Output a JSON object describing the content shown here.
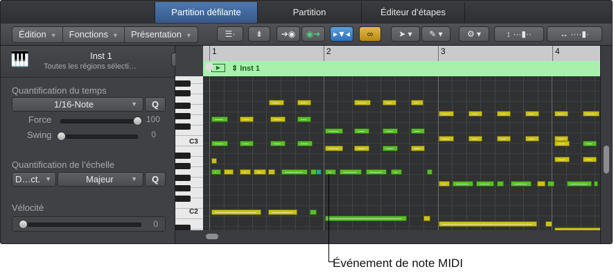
{
  "tabs": [
    {
      "label": "Partition défilante",
      "active": true
    },
    {
      "label": "Partition",
      "active": false
    },
    {
      "label": "Éditeur d’étapes",
      "active": false
    }
  ],
  "toolbar": {
    "menus": [
      "Édition",
      "Fonctions",
      "Présentation"
    ],
    "icons": [
      "hierarchy-icon",
      "collapse-icon",
      "midi-in-icon",
      "midi-out-icon",
      "catch-icon",
      "link-icon",
      "pointer-tool-icon",
      "pencil-tool-icon",
      "gear-icon",
      "vertical-zoom-icon",
      "horizontal-zoom-icon"
    ]
  },
  "inspector": {
    "instrument_name": "Inst 1",
    "instrument_sub": "Toutes les régions sélecti…",
    "time_quant_title": "Quantification du temps",
    "time_quant_value": "1/16-Note",
    "q_label": "Q",
    "force_label": "Force",
    "force_value": "100",
    "force_level": 1.0,
    "swing_label": "Swing",
    "swing_value": "0",
    "swing_level": 0,
    "scale_quant_title": "Quantification de l’échelle",
    "scale_root": "D…ct.",
    "scale_mode": "Majeur",
    "velocity_title": "Vélocité",
    "velocity_value": "0",
    "velocity_level": 0
  },
  "ruler": {
    "bars": [
      "1",
      "2",
      "3",
      "4"
    ]
  },
  "region": {
    "name": "Inst 1"
  },
  "keyboard": {
    "labels": [
      "C3",
      "C2"
    ]
  },
  "callout": {
    "text": "Événement de note MIDI"
  },
  "colors": {
    "note_yellow": "#c9c21a",
    "note_green": "#5bbd2b",
    "region": "#a9f0ad",
    "active_tab": "#3f6aa0"
  }
}
